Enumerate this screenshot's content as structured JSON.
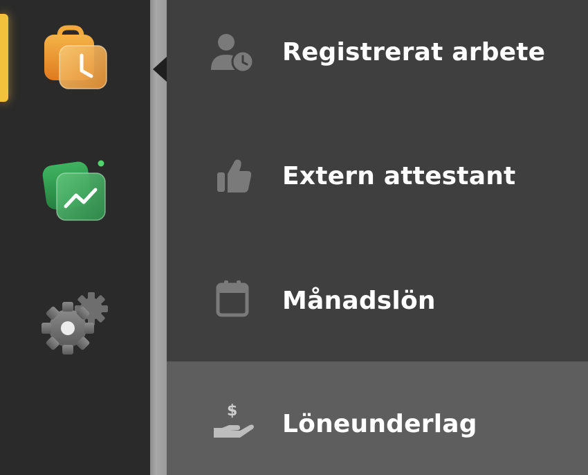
{
  "rail": {
    "items": [
      {
        "id": "time",
        "icon": "briefcase-clock-icon",
        "active": true
      },
      {
        "id": "statistics",
        "icon": "trend-chart-icon",
        "active": false,
        "has_notification": true
      },
      {
        "id": "settings",
        "icon": "gears-icon",
        "active": false
      }
    ],
    "accent_color": "#f2c23c"
  },
  "submenu": {
    "items": [
      {
        "label": "Registrerat arbete",
        "icon": "user-clock-icon",
        "active": false
      },
      {
        "label": "Extern attestant",
        "icon": "thumbs-up-icon",
        "active": false
      },
      {
        "label": "Månadslön",
        "icon": "calendar-icon",
        "active": false
      },
      {
        "label": "Löneunderlag",
        "icon": "hand-dollar-icon",
        "active": true
      }
    ]
  }
}
